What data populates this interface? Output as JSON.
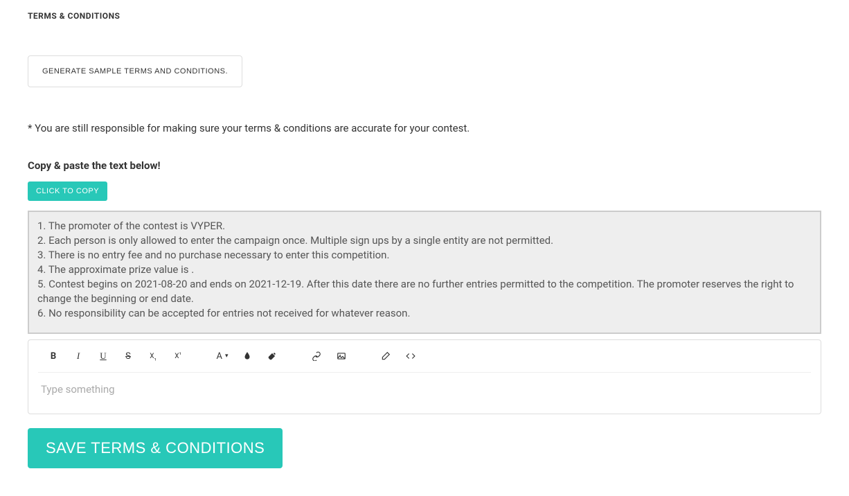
{
  "header": {
    "title": "TERMS & CONDITIONS"
  },
  "buttons": {
    "generate": "GENERATE SAMPLE TERMS AND CONDITIONS.",
    "copy": "CLICK TO COPY",
    "save": "SAVE TERMS & CONDITIONS"
  },
  "text": {
    "disclaimer": "* You are still responsible for making sure your terms & conditions are accurate for your contest.",
    "copy_instruction": "Copy & paste the text below!"
  },
  "terms": {
    "lines": [
      "1. The promoter of the contest is VYPER.",
      "2. Each person is only allowed to enter the campaign once. Multiple sign ups by a single entity are not permitted.",
      "3. There is no entry fee and no purchase necessary to enter this competition.",
      "4. The approximate prize value is .",
      "5. Contest begins on 2021-08-20 and ends on 2021-12-19. After this date there are no further entries permitted to the competition. The promoter reserves the right to change the beginning or end date.",
      "6. No responsibility can be accepted for entries not received for whatever reason."
    ]
  },
  "editor": {
    "placeholder": "Type something"
  },
  "toolbar": {
    "bold": "B",
    "italic": "I",
    "underline": "U",
    "strike": "S",
    "subscript": "X",
    "superscript": "X",
    "font": "A"
  }
}
